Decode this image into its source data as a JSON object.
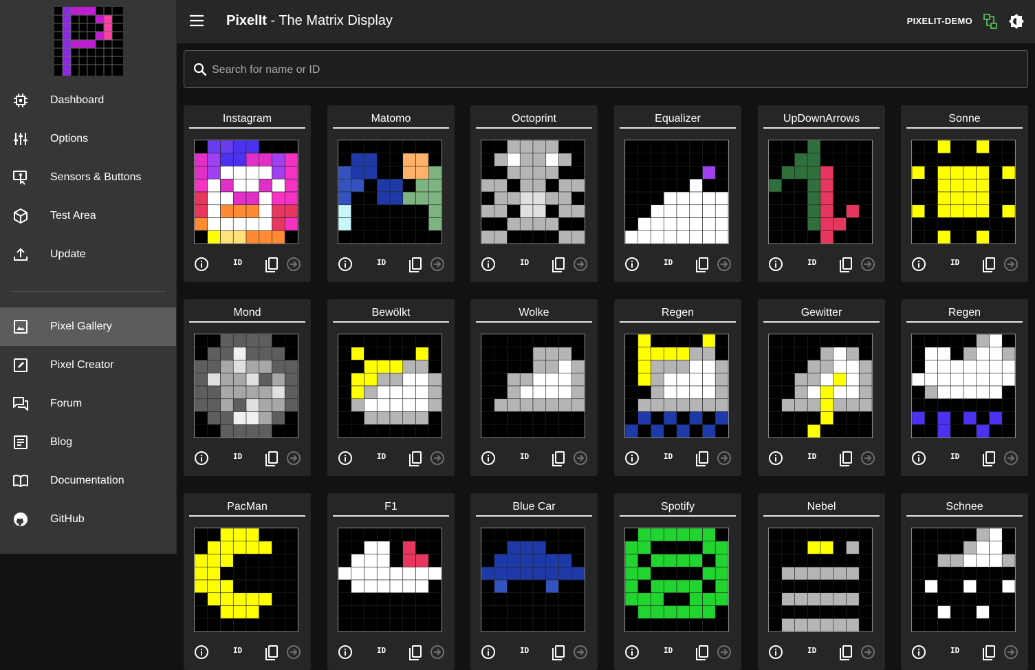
{
  "app": {
    "brand": "PixelIt",
    "subtitle": " - The Matrix Display",
    "device": "PIXELIT-DEMO"
  },
  "sidebar": {
    "items": [
      {
        "label": "Dashboard",
        "icon": "chip-icon"
      },
      {
        "label": "Options",
        "icon": "sliders-icon"
      },
      {
        "label": "Sensors & Buttons",
        "icon": "touch-icon"
      },
      {
        "label": "Test Area",
        "icon": "cube-icon"
      },
      {
        "label": "Update",
        "icon": "upload-icon"
      },
      {
        "label": "Pixel Gallery",
        "icon": "image-icon"
      },
      {
        "label": "Pixel Creator",
        "icon": "pencil-icon"
      },
      {
        "label": "Forum",
        "icon": "forum-icon"
      },
      {
        "label": "Blog",
        "icon": "blog-icon"
      },
      {
        "label": "Documentation",
        "icon": "book-icon"
      },
      {
        "label": "GitHub",
        "icon": "github-icon"
      }
    ],
    "active": "Pixel Gallery"
  },
  "search": {
    "placeholder": "Search for name or ID"
  },
  "card_actions": {
    "id_label": "ID"
  },
  "colors": {
    "bg": "#121212",
    "appbar": "#272727",
    "sidebar": "#363636",
    "card": "#262626",
    "active_nav": "#5b5b5b",
    "connected": "#4caf50"
  },
  "gallery": [
    {
      "title": "Instagram",
      "pixels": [
        "K77BBKKK",
        "pPBBppPM",
        "pPWWWWPM",
        "MWpWWpWM",
        "RWWppWMM",
        "RWoooWRR",
        "oWWWWWRM",
        "KYyyoooK"
      ]
    },
    {
      "title": "Matomo",
      "pixels": [
        "KKKKKKKK",
        "KbbKKHHK",
        "dbbKKHHg",
        "ddKbbKgg",
        "dKKbbggg",
        "cKKKKKKg",
        "cKKKKKKg",
        "KKKKKKKK"
      ]
    },
    {
      "title": "Octoprint",
      "pixels": [
        "KKGGGGKK",
        "KGWGGWGK",
        "KKGGGGKK",
        "GGKGGKGG",
        "KGGLLGGK",
        "GGKLLKGG",
        "KKGGGGKK",
        "GGKKKKGG"
      ]
    },
    {
      "title": "Equalizer",
      "pixels": [
        "KKKKKKKK",
        "KKKKKKKK",
        "KKKKKKPK",
        "KKKKKWKK",
        "KKKWWWWW",
        "KKWWWWWW",
        "KWWWWWWW",
        "WWWWWWWW"
      ]
    },
    {
      "title": "UpDownArrows",
      "pixels": [
        "KKKDKKKK",
        "KKDDKKKK",
        "KDDDRKKK",
        "DKKDRKKK",
        "KKKDRKKK",
        "KKKDRKRK",
        "KKKDRRKK",
        "KKKKRKKK"
      ]
    },
    {
      "title": "Sonne",
      "pixels": [
        "KKYKKYKK",
        "KKKKKKKK",
        "YKYYYYKY",
        "KKYYYYKK",
        "KKYYYYKK",
        "YKYYYYKY",
        "KKKKKKKK",
        "KKYKKYKK"
      ]
    },
    {
      "title": "Mond",
      "pixels": [
        "KK5555KK",
        "K554555K",
        "556L6655",
        "5L66L565",
        "556666L5",
        "5565L665",
        "K554465K",
        "KK5555KK"
      ]
    },
    {
      "title": "Bewölkt",
      "pixels": [
        "KKKKKKKK",
        "KYKKKKYK",
        "KKYYYGGK",
        "KYYGGWWG",
        "KYGWWWWG",
        "KGWWWWWG",
        "KKGGGGGK",
        "KKKKKKKK"
      ]
    },
    {
      "title": "Wolke",
      "pixels": [
        "KKKKKKKK",
        "KKKKGGGK",
        "KKKKGGWG",
        "KKGGWWWG",
        "KKGWWWWG",
        "KGGGGGGG",
        "KKKKKKKK",
        "KKKKKKKK"
      ]
    },
    {
      "title": "Regen",
      "pixels": [
        "KYKKKKYK",
        "KYYYYGGK",
        "KYGGGWWG",
        "KYGWWWWG",
        "KKGWWWWG",
        "KGGGGGGG",
        "KbKbKbKb",
        "bKbKbKbK"
      ]
    },
    {
      "title": "Gewitter",
      "pixels": [
        "KKKKKKKK",
        "KKKKGWGK",
        "KKKGGWWG",
        "KKGGWYWG",
        "KKGWYWWG",
        "KGGGYGGG",
        "KKKKYKKK",
        "KKKYKKKK"
      ]
    },
    {
      "title": "Regen",
      "pixels": [
        "KKKKKGWK",
        "KWWKGWWG",
        "KWWWWWWW",
        "WWWWWWWW",
        "KGWWWWWK",
        "KKKKKKKK",
        "BKBKBKBK",
        "KKBKKBKK"
      ]
    },
    {
      "title": "PacMan",
      "pixels": [
        "KKYYYKKK",
        "KYYYYYKK",
        "YYYKKKKK",
        "YYKKKKKK",
        "YYYKKKKK",
        "KYYYYYKK",
        "KKYYYKKK",
        "KKKKKKKK"
      ]
    },
    {
      "title": "F1",
      "pixels": [
        "KKKKKKKK",
        "KKWWKRKK",
        "KWWWKRRK",
        "WWWWWWWW",
        "KWWWWWWK",
        "KKKKKKKK",
        "KKKKKKKK",
        "KKKKKKKK"
      ]
    },
    {
      "title": "Blue Car",
      "pixels": [
        "KKKKKKKK",
        "KKbbbKKK",
        "KbbbbbbK",
        "bbbbbbbb",
        "KdKKKdKK",
        "KKKKKKKK",
        "KKKKKKKK",
        "KKKKKKKK"
      ]
    },
    {
      "title": "Spotify",
      "pixels": [
        "KNNNNNNK",
        "NNKKKKNN",
        "NKNNNNKN",
        "NNKKKKNN",
        "NKNNNNKN",
        "NNNKKNNN",
        "KNNNNNNK",
        "KKKKKKKK"
      ]
    },
    {
      "title": "Nebel",
      "pixels": [
        "KKKKKKKK",
        "KKKYYKGK",
        "KKKKKKKK",
        "KGGGGGGK",
        "KKKKKKKK",
        "KGGGGGGK",
        "KKKKKKKK",
        "KGGGGGGK"
      ]
    },
    {
      "title": "Schnee",
      "pixels": [
        "KKKKKGWK",
        "KKKKGWWK",
        "KKGGWWWG",
        "KKKKKKKK",
        "KWKKWKKW",
        "KKKKKKKK",
        "KKWKKWKK",
        "KKKKKKKK"
      ]
    }
  ],
  "palette": {
    "K": "#000000",
    "W": "#ffffff",
    "G": "#b5b5b5",
    "L": "#e0e0e0",
    "Y": "#ffff00",
    "y": "#ffe27a",
    "R": "#e8375f",
    "o": "#ff8a34",
    "p": "#e030c8",
    "P": "#a140f0",
    "M": "#f532c2",
    "B": "#4b32f0",
    "7": "#6a3cf0",
    "b": "#1e3aa8",
    "d": "#3553be",
    "H": "#ffb36a",
    "g": "#7eb382",
    "c": "#c8f5f7",
    "D": "#2e6f3c",
    "N": "#22d42f",
    "4": "#f0f0f0",
    "5": "#5e5e5e",
    "6": "#a8a8a8"
  }
}
